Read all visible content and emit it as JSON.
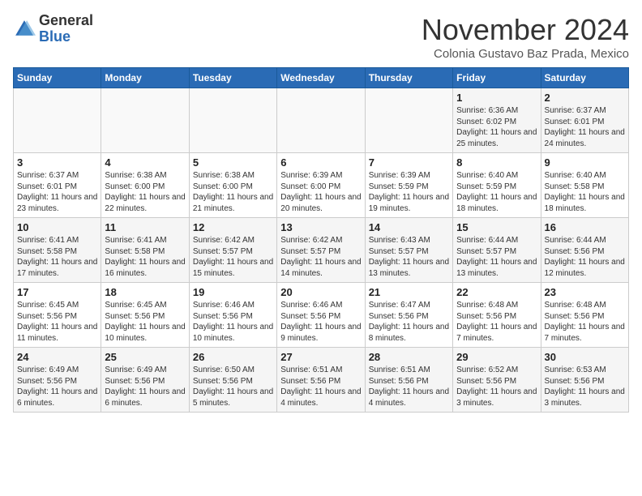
{
  "logo": {
    "general": "General",
    "blue": "Blue"
  },
  "title": "November 2024",
  "subtitle": "Colonia Gustavo Baz Prada, Mexico",
  "days_header": [
    "Sunday",
    "Monday",
    "Tuesday",
    "Wednesday",
    "Thursday",
    "Friday",
    "Saturday"
  ],
  "weeks": [
    [
      {
        "day": "",
        "info": ""
      },
      {
        "day": "",
        "info": ""
      },
      {
        "day": "",
        "info": ""
      },
      {
        "day": "",
        "info": ""
      },
      {
        "day": "",
        "info": ""
      },
      {
        "day": "1",
        "info": "Sunrise: 6:36 AM\nSunset: 6:02 PM\nDaylight: 11 hours and 25 minutes."
      },
      {
        "day": "2",
        "info": "Sunrise: 6:37 AM\nSunset: 6:01 PM\nDaylight: 11 hours and 24 minutes."
      }
    ],
    [
      {
        "day": "3",
        "info": "Sunrise: 6:37 AM\nSunset: 6:01 PM\nDaylight: 11 hours and 23 minutes."
      },
      {
        "day": "4",
        "info": "Sunrise: 6:38 AM\nSunset: 6:00 PM\nDaylight: 11 hours and 22 minutes."
      },
      {
        "day": "5",
        "info": "Sunrise: 6:38 AM\nSunset: 6:00 PM\nDaylight: 11 hours and 21 minutes."
      },
      {
        "day": "6",
        "info": "Sunrise: 6:39 AM\nSunset: 6:00 PM\nDaylight: 11 hours and 20 minutes."
      },
      {
        "day": "7",
        "info": "Sunrise: 6:39 AM\nSunset: 5:59 PM\nDaylight: 11 hours and 19 minutes."
      },
      {
        "day": "8",
        "info": "Sunrise: 6:40 AM\nSunset: 5:59 PM\nDaylight: 11 hours and 18 minutes."
      },
      {
        "day": "9",
        "info": "Sunrise: 6:40 AM\nSunset: 5:58 PM\nDaylight: 11 hours and 18 minutes."
      }
    ],
    [
      {
        "day": "10",
        "info": "Sunrise: 6:41 AM\nSunset: 5:58 PM\nDaylight: 11 hours and 17 minutes."
      },
      {
        "day": "11",
        "info": "Sunrise: 6:41 AM\nSunset: 5:58 PM\nDaylight: 11 hours and 16 minutes."
      },
      {
        "day": "12",
        "info": "Sunrise: 6:42 AM\nSunset: 5:57 PM\nDaylight: 11 hours and 15 minutes."
      },
      {
        "day": "13",
        "info": "Sunrise: 6:42 AM\nSunset: 5:57 PM\nDaylight: 11 hours and 14 minutes."
      },
      {
        "day": "14",
        "info": "Sunrise: 6:43 AM\nSunset: 5:57 PM\nDaylight: 11 hours and 13 minutes."
      },
      {
        "day": "15",
        "info": "Sunrise: 6:44 AM\nSunset: 5:57 PM\nDaylight: 11 hours and 13 minutes."
      },
      {
        "day": "16",
        "info": "Sunrise: 6:44 AM\nSunset: 5:56 PM\nDaylight: 11 hours and 12 minutes."
      }
    ],
    [
      {
        "day": "17",
        "info": "Sunrise: 6:45 AM\nSunset: 5:56 PM\nDaylight: 11 hours and 11 minutes."
      },
      {
        "day": "18",
        "info": "Sunrise: 6:45 AM\nSunset: 5:56 PM\nDaylight: 11 hours and 10 minutes."
      },
      {
        "day": "19",
        "info": "Sunrise: 6:46 AM\nSunset: 5:56 PM\nDaylight: 11 hours and 10 minutes."
      },
      {
        "day": "20",
        "info": "Sunrise: 6:46 AM\nSunset: 5:56 PM\nDaylight: 11 hours and 9 minutes."
      },
      {
        "day": "21",
        "info": "Sunrise: 6:47 AM\nSunset: 5:56 PM\nDaylight: 11 hours and 8 minutes."
      },
      {
        "day": "22",
        "info": "Sunrise: 6:48 AM\nSunset: 5:56 PM\nDaylight: 11 hours and 7 minutes."
      },
      {
        "day": "23",
        "info": "Sunrise: 6:48 AM\nSunset: 5:56 PM\nDaylight: 11 hours and 7 minutes."
      }
    ],
    [
      {
        "day": "24",
        "info": "Sunrise: 6:49 AM\nSunset: 5:56 PM\nDaylight: 11 hours and 6 minutes."
      },
      {
        "day": "25",
        "info": "Sunrise: 6:49 AM\nSunset: 5:56 PM\nDaylight: 11 hours and 6 minutes."
      },
      {
        "day": "26",
        "info": "Sunrise: 6:50 AM\nSunset: 5:56 PM\nDaylight: 11 hours and 5 minutes."
      },
      {
        "day": "27",
        "info": "Sunrise: 6:51 AM\nSunset: 5:56 PM\nDaylight: 11 hours and 4 minutes."
      },
      {
        "day": "28",
        "info": "Sunrise: 6:51 AM\nSunset: 5:56 PM\nDaylight: 11 hours and 4 minutes."
      },
      {
        "day": "29",
        "info": "Sunrise: 6:52 AM\nSunset: 5:56 PM\nDaylight: 11 hours and 3 minutes."
      },
      {
        "day": "30",
        "info": "Sunrise: 6:53 AM\nSunset: 5:56 PM\nDaylight: 11 hours and 3 minutes."
      }
    ]
  ]
}
